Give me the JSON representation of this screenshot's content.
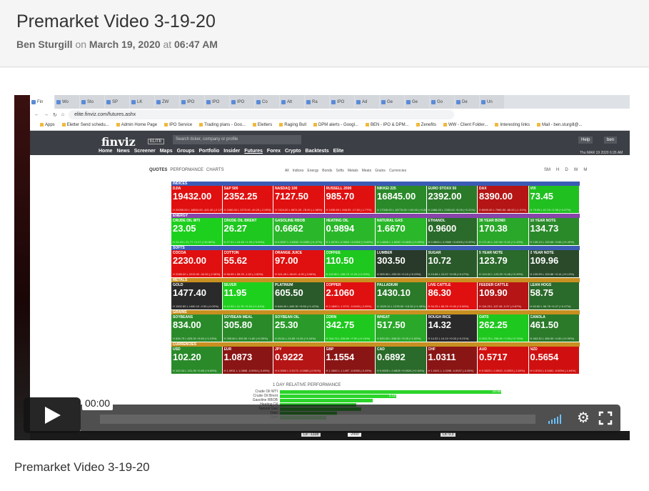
{
  "post": {
    "title": "Premarket Video 3-19-20",
    "author": "Ben Sturgill",
    "on_word": "on",
    "date": "March 19, 2020",
    "at_word": "at",
    "time": "06:47 AM",
    "caption": "Premarket Video 3-19-20"
  },
  "browser": {
    "tabs": [
      "Fin",
      "Wo",
      "Sto",
      "SP",
      "LK",
      "ZW",
      "IPO",
      "IPO",
      "IPO",
      "Co",
      "Alt",
      "Ra",
      "IPO",
      "Ad",
      "Ge",
      "Ge",
      "Go",
      "De",
      "Un"
    ],
    "url": "elite.finviz.com/futures.ashx",
    "bookmarks": [
      "Apps",
      "Eletter Send schedu...",
      "Admin Home Page",
      "IPO Service",
      "Trading plans - Goo...",
      "Eletters",
      "Raging Bull",
      "DPM alerts - Googl...",
      "BEN - IPO & DPM...",
      "Zenefits",
      "WW - Client Folder...",
      "Interesting links",
      "Mail - ben.sturgill@..."
    ]
  },
  "finviz": {
    "logo": "finviz",
    "badge": "ELITE",
    "search_placeholder": "Search ticker, company or profile",
    "menu": [
      "Home",
      "News",
      "Screener",
      "Maps",
      "Groups",
      "Portfolio",
      "Insider",
      "Futures",
      "Forex",
      "Crypto",
      "Backtests",
      "Elite"
    ],
    "help": "Help",
    "user": "ben",
    "datetime": "Thu MAR 19 2020 6:26 AM EST",
    "subtabs": [
      "QUOTES",
      "PERFORMANCE",
      "CHARTS"
    ],
    "filters": [
      "All",
      "Indices",
      "Energy",
      "Bonds",
      "Softs",
      "Metals",
      "Meats",
      "Grains",
      "Currencies"
    ],
    "timeframes": [
      "SM",
      "H",
      "D",
      "W",
      "M"
    ]
  },
  "sections": [
    {
      "name": "INDICES",
      "color": "#3b5bb5",
      "rows": [
        [
          {
            "n": "DJIA",
            "v": "19432.00",
            "l": "H 20095.00 L 18834.00 -421.00 (-2.12%)",
            "c": "#e01010"
          },
          {
            "n": "S&P 500",
            "v": "2352.25",
            "l": "H 2460.00 L 2273.00 -49.25 (-2.05%)",
            "c": "#e01010"
          },
          {
            "n": "NASDAQ 100",
            "v": "7127.50",
            "l": "H 7424.00 L 6874.25 -78.00 (-1.08%)",
            "c": "#e01010"
          },
          {
            "n": "RUSSELL 2000",
            "v": "985.70",
            "l": "H 1035.50 L 948.30 -17.80 (-1.77%)",
            "c": "#e01010"
          },
          {
            "n": "NIKKEI 225",
            "v": "16845.00",
            "l": "H 17345.00 L 16775.00 +110.00 (+0.66%)",
            "c": "#2a8a2a"
          },
          {
            "n": "EURO STOXX 50",
            "v": "2392.00",
            "l": "H 2466.00 L 2333.00 +5.00 (+0.21%)",
            "c": "#2a7a2a"
          },
          {
            "n": "DAX",
            "v": "8390.00",
            "l": "H 8699.00 L 7960.50 -86.00 (-1.01%)",
            "c": "#b51515"
          },
          {
            "n": "VIX",
            "v": "73.45",
            "l": "H 79.95 L 67.25 +2.95 (+4.37%)",
            "c": "#20c020"
          }
        ]
      ]
    },
    {
      "name": "ENERGY",
      "color": "#8844aa",
      "rows": [
        [
          {
            "n": "CRUDE OIL WTI",
            "v": "23.05",
            "l": "H 24.45 L 21.77 +2.27 (+10.66%)",
            "c": "#1ed01e"
          },
          {
            "n": "CRUDE OIL BRENT",
            "v": "26.27",
            "l": "H 27.31 L 24.96 +1.39 (+5.59%)",
            "c": "#1ec81e"
          },
          {
            "n": "GASOLINE RBOB",
            "v": "0.6662",
            "l": "H 0.6937 L 0.6306 +0.0285 (+4.47%)",
            "c": "#2ab82a"
          },
          {
            "n": "HEATING OIL",
            "v": "0.9894",
            "l": "H 1.0078 L 0.9604 +0.0352 (+3.69%)",
            "c": "#2ab82a"
          },
          {
            "n": "NATURAL GAS",
            "v": "1.6670",
            "l": "H 1.6840 L 1.6000 +0.0630 (+3.93%)",
            "c": "#2ab82a"
          },
          {
            "n": "ETHANOL",
            "v": "0.9600",
            "l": "H 0.9600 L 0.9560 +0.0000 (+0.00%)",
            "c": "#2a6a2a"
          },
          {
            "n": "30 YEAR BOND",
            "v": "170.38",
            "l": "H 171.81 L 167.84 +2.41 (+1.43%)",
            "c": "#2aa82a"
          },
          {
            "n": "10 YEAR NOTE",
            "v": "134.73",
            "l": "H 135.13 L 133.66 +0.66 (+0.49%)",
            "c": "#2a8a2a"
          }
        ]
      ]
    },
    {
      "name": "SOFTS",
      "color": "#3b5bb5",
      "rows": [
        [
          {
            "n": "COCOA",
            "v": "2230.00",
            "l": "H 2285.00 L 2215.00 -34.00 (-2.36%)",
            "c": "#e01010"
          },
          {
            "n": "COTTON",
            "v": "55.62",
            "l": "H 56.95 L 55.20 -1.02 (-1.80%)",
            "c": "#e01010"
          },
          {
            "n": "ORANGE JUICE",
            "v": "97.00",
            "l": "H 101.45 L 96.00 -4.00 (-3.96%)",
            "c": "#e01010"
          },
          {
            "n": "COFFEE",
            "v": "110.50",
            "l": "H 110.80 L 108.70 +2.20 (+2.03%)",
            "c": "#1ec81e"
          },
          {
            "n": "LUMBER",
            "v": "303.50",
            "l": "H 309.90 L 293.00 +0.10 (+0.03%)",
            "c": "#2a3a2a"
          },
          {
            "n": "SUGAR",
            "v": "10.72",
            "l": "H 10.86 L 10.67 +0.05 (+0.47%)",
            "c": "#2a5a2a"
          },
          {
            "n": "5 YEAR NOTE",
            "v": "123.79",
            "l": "H 124.02 L 123.25 +0.48 (+0.39%)",
            "c": "#2a6a2a"
          },
          {
            "n": "2 YEAR NOTE",
            "v": "109.96",
            "l": "H 109.99 L 109.86 +0.14 (+0.13%)",
            "c": "#2a4a2a"
          }
        ]
      ]
    },
    {
      "name": "METALS",
      "color": "#c89020",
      "rows": [
        [
          {
            "n": "GOLD",
            "v": "1477.40",
            "l": "H 1502.80 L 1460.10 -0.50 (-0.03%)",
            "c": "#2a2a2a"
          },
          {
            "n": "SILVER",
            "v": "11.95",
            "l": "H 12.33 L 11.76 +0.18 (+1.51%)",
            "c": "#1ed01e"
          },
          {
            "n": "PLATINUM",
            "v": "605.50",
            "l": "H 648.40 L 600.30 +8.50 (+1.42%)",
            "c": "#2a5a2a"
          },
          {
            "n": "COPPER",
            "v": "2.1060",
            "l": "H 2.1880 L 1.9721 -0.0450 (-2.09%)",
            "c": "#e01010"
          },
          {
            "n": "PALLADIUM",
            "v": "1430.10",
            "l": "H 1525.10 L 1378.00 +15.30 (+1.08%)",
            "c": "#2a7a2a"
          },
          {
            "n": "LIVE CATTLE",
            "v": "86.30",
            "l": "H 94.25 L 85.25 +0.50 (+0.58%)",
            "c": "#e01010"
          },
          {
            "n": "FEEDER CATTLE",
            "v": "109.90",
            "l": "H 116.25 L 107.48 -0.97 (-0.87%)",
            "c": "#b51515"
          },
          {
            "n": "LEAN HOGS",
            "v": "58.75",
            "l": "H 62.80 L 56.78 +0.27 (+0.47%)",
            "c": "#2a6a2a"
          }
        ]
      ]
    },
    {
      "name": "GRAINS",
      "color": "#c89020",
      "rows": [
        [
          {
            "n": "SOYBEANS",
            "v": "834.00",
            "l": "H 836.75 L 825.00 +8.50 (+1.03%)",
            "c": "#2a8a2a"
          },
          {
            "n": "SOYBEAN MEAL",
            "v": "305.80",
            "l": "H 305.80 L 300.50 +1.80 (+0.59%)",
            "c": "#2a8a2a"
          },
          {
            "n": "SOYBEAN OIL",
            "v": "25.30",
            "l": "H 25.61 L 24.85 +0.26 (+1.04%)",
            "c": "#2a9a2a"
          },
          {
            "n": "CORN",
            "v": "342.75",
            "l": "H 344.75 L 336.50 +7.50 (+2.24%)",
            "c": "#1ec81e"
          },
          {
            "n": "WHEAT",
            "v": "517.50",
            "l": "H 520.25 L 508.50 +9.25 (+1.82%)",
            "c": "#2aa82a"
          },
          {
            "n": "ROUGH RICE",
            "v": "14.32",
            "l": "H 14.32 L 14.10 +0.03 (+0.21%)",
            "c": "#2a2a2a"
          },
          {
            "n": "OATS",
            "v": "262.25",
            "l": "H 263.75 L 256.00 +7.00 (+2.74%)",
            "c": "#1ec81e"
          },
          {
            "n": "CANOLA",
            "v": "461.50",
            "l": "H 463.30 L 456.90 +4.50 (+0.99%)",
            "c": "#2a7a2a"
          }
        ]
      ]
    },
    {
      "name": "CURRENCIES",
      "color": "#c89020",
      "rows": [
        [
          {
            "n": "USD",
            "v": "102.20",
            "l": "H 102.34 L 101.05 +0.66 (+0.65%)",
            "c": "#2a8a2a"
          },
          {
            "n": "EUR",
            "v": "1.0873",
            "l": "H 1.0931 L 1.0858 -0.0054 (-0.49%)",
            "c": "#8a1515"
          },
          {
            "n": "JPY",
            "v": "0.9222",
            "l": "H 0.9300 L 0.9173 -0.0085 (-0.91%)",
            "c": "#b51515"
          },
          {
            "n": "GBP",
            "v": "1.1554",
            "l": "H 1.1660 L 1.1497 -0.0050 (-0.43%)",
            "c": "#8a1515"
          },
          {
            "n": "CAD",
            "v": "0.6892",
            "l": "H 0.6925 L 0.6828 +0.0024 (+0.34%)",
            "c": "#2a6a2a"
          },
          {
            "n": "CHF",
            "v": "1.0311",
            "l": "H 1.0421 L 1.0298 -0.0037 (-0.35%)",
            "c": "#8a1515"
          },
          {
            "n": "AUD",
            "v": "0.5717",
            "l": "H 0.5823 L 0.5510 -0.0093 (-1.60%)",
            "c": "#d01010"
          },
          {
            "n": "NZD",
            "v": "0.5654",
            "l": "H 0.5763 L 0.5461 -0.0094 (-1.64%)",
            "c": "#d01010"
          }
        ]
      ]
    }
  ],
  "performance": {
    "title": "1 DAY RELATIVE PERFORMANCE",
    "bars": [
      {
        "label": "Crude Oil WTI",
        "value": 10.66,
        "text": "10.66"
      },
      {
        "label": "Crude Oil Brent",
        "value": 5.59,
        "text": "5.59"
      },
      {
        "label": "Gasoline RBOB",
        "value": 4.47,
        "text": ""
      },
      {
        "label": "Heating Oil",
        "value": 3.69,
        "text": ""
      },
      {
        "label": "Natural Gas",
        "value": 3.93,
        "text": ""
      },
      {
        "label": "Oats",
        "value": 2.74,
        "text": ""
      },
      {
        "label": "Corn",
        "value": 2.24,
        "text": ""
      }
    ]
  },
  "chart_strip": {
    "lo1": "Lo: -1328",
    "lo2": "-2000",
    "lo3": "Lo: 0.3"
  },
  "player": {
    "time": "00:00"
  }
}
